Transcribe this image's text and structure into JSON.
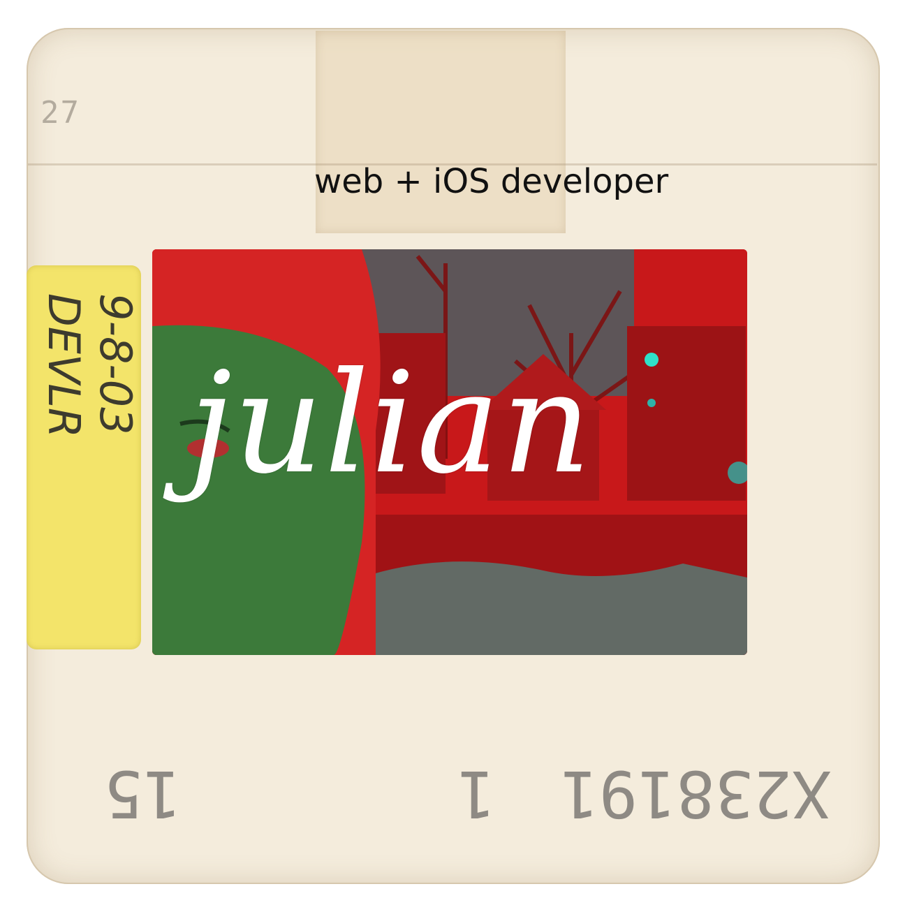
{
  "slide": {
    "frame_number": "27",
    "subtitle": "web + iOS developer",
    "title": "julian",
    "sticker_lines": [
      "9-8-03",
      "DEVLR"
    ],
    "bottom_code": "X238191",
    "bottom_mark": "1",
    "bottom_number": "15"
  },
  "colors": {
    "mount": "#f4ecdc",
    "sticker": "#f3e46a",
    "photo_red": "#c8181a",
    "photo_teal": "#2fb2a8",
    "photo_green": "#3c7a3a"
  }
}
